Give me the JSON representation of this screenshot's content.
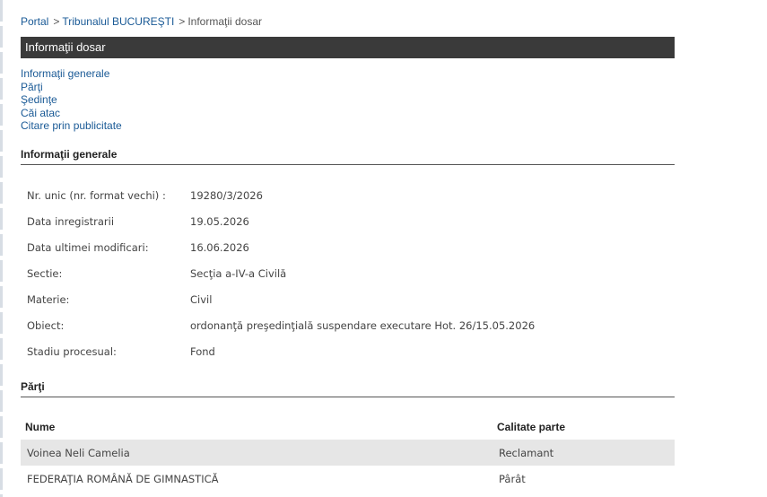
{
  "breadcrumb": {
    "items": [
      "Portal",
      "Tribunalul BUCUREŞTI",
      "Informaţii dosar"
    ],
    "separator": ">"
  },
  "title_bar": {
    "title": "Informaţii dosar"
  },
  "nav": {
    "links": [
      "Informaţii generale",
      "Părţi",
      "Şedinţe",
      "Căi atac",
      "Citare prin publicitate"
    ]
  },
  "general_info": {
    "heading": "Informaţii generale",
    "rows": [
      {
        "label": "Nr. unic (nr. format vechi) :",
        "value": "19280/3/2026"
      },
      {
        "label": "Data inregistrarii",
        "value": "19.05.2026"
      },
      {
        "label": "Data ultimei modificari:",
        "value": "16.06.2026"
      },
      {
        "label": "Sectie:",
        "value": "Secţia a-IV-a Civilă"
      },
      {
        "label": "Materie:",
        "value": "Civil"
      },
      {
        "label": "Obiect:",
        "value": "ordonanţă preşedinţială suspendare executare Hot. 26/15.05.2026"
      },
      {
        "label": "Stadiu procesual:",
        "value": "Fond"
      }
    ]
  },
  "parties": {
    "heading": "Părţi",
    "columns": [
      "Nume",
      "Calitate parte"
    ],
    "rows": [
      {
        "name": "Voinea Neli Camelia",
        "role": "Reclamant"
      },
      {
        "name": "FEDERAŢIA ROMÂNĂ DE GIMNASTICĂ",
        "role": "Pârât"
      }
    ]
  },
  "colors": {
    "link": "#1a5a96",
    "title_bar_bg": "#3a3a3a",
    "row_shade": "#e6e6e6"
  }
}
